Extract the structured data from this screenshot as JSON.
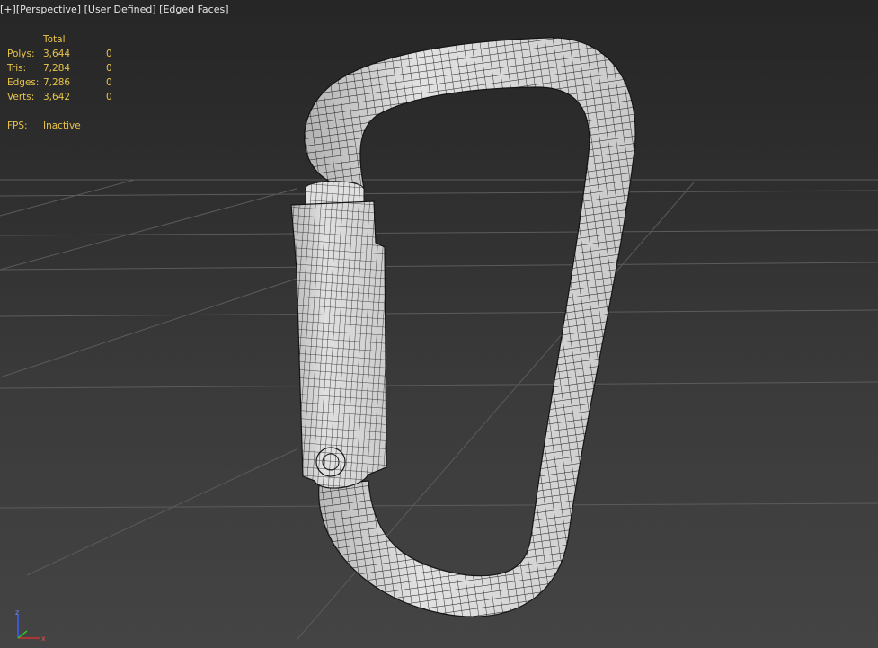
{
  "viewport": {
    "menu_plus": "[+]",
    "view_name": "[Perspective]",
    "display_mode": "[User Defined]",
    "shading": "[Edged Faces]"
  },
  "stats": {
    "header": "Total",
    "rows": [
      {
        "label": "Polys:",
        "total": "3,644",
        "selected": "0"
      },
      {
        "label": "Tris:",
        "total": "7,284",
        "selected": "0"
      },
      {
        "label": "Edges:",
        "total": "7,286",
        "selected": "0"
      },
      {
        "label": "Verts:",
        "total": "3,642",
        "selected": "0"
      }
    ],
    "fps_label": "FPS:",
    "fps_value": "Inactive"
  },
  "axis_gizmo": {
    "z": "z",
    "x": "x"
  },
  "colors": {
    "stats_text": "#e8c44a",
    "label_text": "#e6e6e6",
    "grid_line": "#5a5a5a",
    "mesh_fill": "#e6e6e6",
    "wire": "#1a1a1a"
  }
}
